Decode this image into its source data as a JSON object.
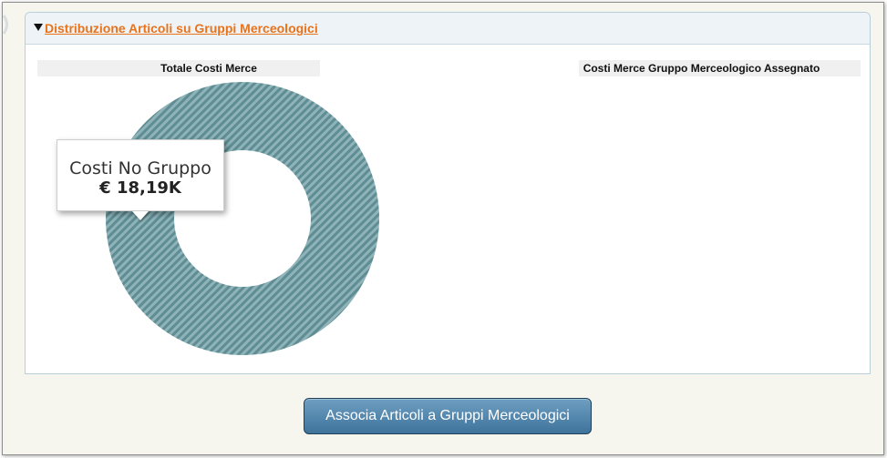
{
  "panel": {
    "title": "Distribuzione Articoli su Gruppi Merceologici"
  },
  "charts": {
    "left_title": "Totale Costi Merce",
    "right_title": "Costi Merce Gruppo Merceologico Assegnato"
  },
  "tooltip": {
    "label": "Costi No Gruppo",
    "value": "€ 18,19K"
  },
  "button": {
    "label": "Associa Articoli a Gruppi Merceologici"
  },
  "colors": {
    "accent_title": "#e8731a",
    "slice_fill": "#5e8d94",
    "slice_stripe": "#8fb3b8"
  },
  "chart_data": [
    {
      "type": "pie",
      "title": "Totale Costi Merce",
      "categories": [
        "Costi No Gruppo"
      ],
      "values": [
        18190
      ],
      "value_labels": [
        "€ 18,19K"
      ],
      "donut": true
    },
    {
      "type": "pie",
      "title": "Costi Merce Gruppo Merceologico Assegnato",
      "categories": [],
      "values": []
    }
  ]
}
